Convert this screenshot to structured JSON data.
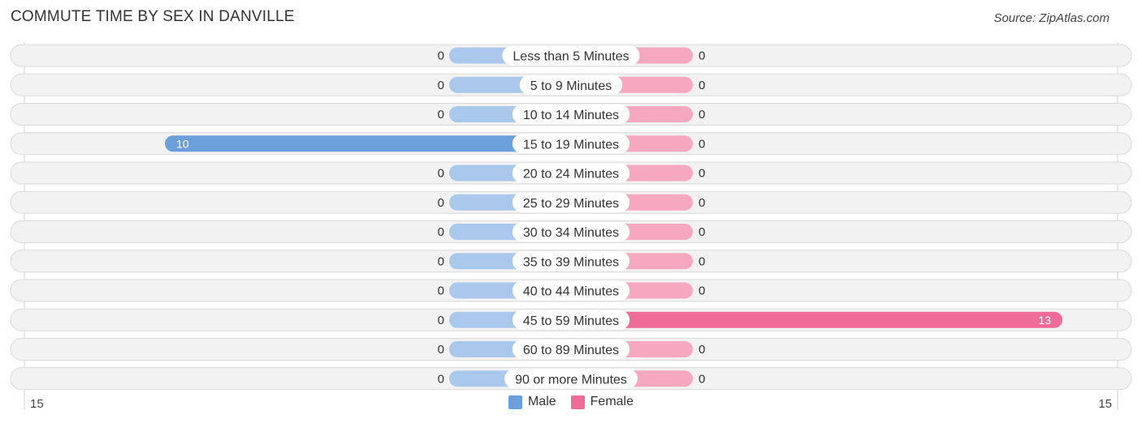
{
  "title": "COMMUTE TIME BY SEX IN DANVILLE",
  "source": "Source: ZipAtlas.com",
  "colors": {
    "male": "#6a9fdb",
    "male_light": "#a9c8ec",
    "female": "#f06c98",
    "female_light": "#f6a8c1",
    "row_bg": "#f2f2f2",
    "row_border": "#d9d9d9"
  },
  "legend": [
    {
      "label": "Male",
      "key": "male"
    },
    {
      "label": "Female",
      "key": "female"
    }
  ],
  "chart_data": {
    "type": "bar",
    "orientation": "horizontal-diverging",
    "title": "COMMUTE TIME BY SEX IN DANVILLE",
    "categories": [
      "Less than 5 Minutes",
      "5 to 9 Minutes",
      "10 to 14 Minutes",
      "15 to 19 Minutes",
      "20 to 24 Minutes",
      "25 to 29 Minutes",
      "30 to 34 Minutes",
      "35 to 39 Minutes",
      "40 to 44 Minutes",
      "45 to 59 Minutes",
      "60 to 89 Minutes",
      "90 or more Minutes"
    ],
    "series": [
      {
        "name": "Male",
        "values": [
          0,
          0,
          0,
          10,
          0,
          0,
          0,
          0,
          0,
          0,
          0,
          0
        ]
      },
      {
        "name": "Female",
        "values": [
          0,
          0,
          0,
          0,
          0,
          0,
          0,
          0,
          0,
          13,
          0,
          0
        ]
      }
    ],
    "axis_range": [
      15,
      15
    ],
    "axis_tick_labels": {
      "left": "15",
      "right": "15"
    },
    "legend_position": "bottom-center",
    "grid": false
  }
}
